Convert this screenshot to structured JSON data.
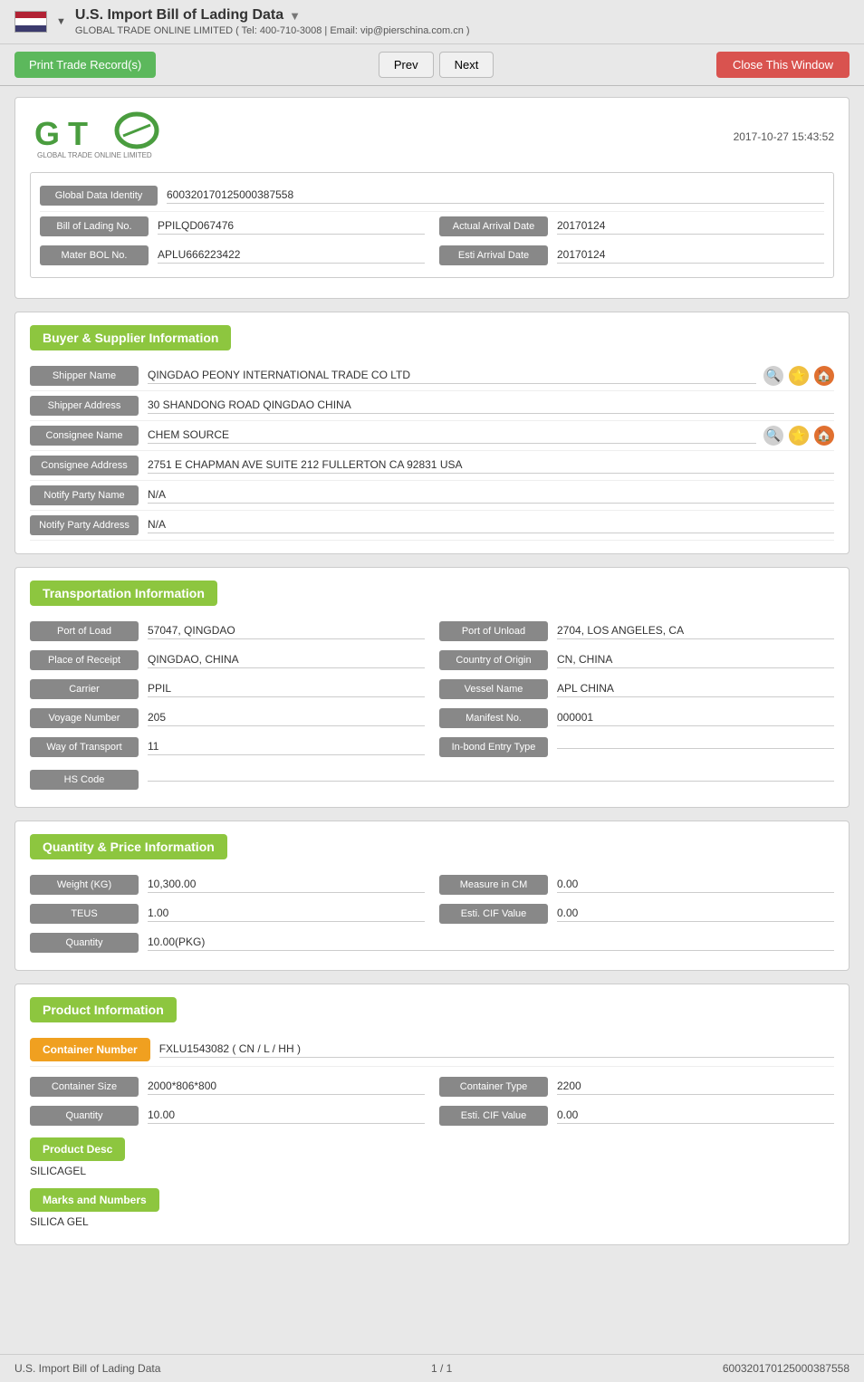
{
  "header": {
    "title": "U.S. Import Bill of Lading Data",
    "subtitle": "GLOBAL TRADE ONLINE LIMITED ( Tel: 400-710-3008 | Email: vip@pierschina.com.cn )",
    "dropdown_arrow": "▼"
  },
  "toolbar": {
    "print_label": "Print Trade Record(s)",
    "prev_label": "Prev",
    "next_label": "Next",
    "close_label": "Close This Window"
  },
  "logo": {
    "datetime": "2017-10-27 15:43:52",
    "subtitle": "GLOBAL TRADE ONLINE LIMITED"
  },
  "global_info": {
    "global_data_identity_label": "Global Data Identity",
    "global_data_identity_value": "600320170125000387558",
    "bill_of_lading_no_label": "Bill of Lading No.",
    "bill_of_lading_no_value": "PPILQD067476",
    "actual_arrival_date_label": "Actual Arrival Date",
    "actual_arrival_date_value": "20170124",
    "mater_bol_no_label": "Mater BOL No.",
    "mater_bol_no_value": "APLU666223422",
    "esti_arrival_date_label": "Esti Arrival Date",
    "esti_arrival_date_value": "20170124"
  },
  "buyer_supplier": {
    "section_title": "Buyer & Supplier Information",
    "shipper_name_label": "Shipper Name",
    "shipper_name_value": "QINGDAO PEONY INTERNATIONAL TRADE CO LTD",
    "shipper_address_label": "Shipper Address",
    "shipper_address_value": "30 SHANDONG ROAD QINGDAO CHINA",
    "consignee_name_label": "Consignee Name",
    "consignee_name_value": "CHEM SOURCE",
    "consignee_address_label": "Consignee Address",
    "consignee_address_value": "2751 E CHAPMAN AVE SUITE 212 FULLERTON CA 92831 USA",
    "notify_party_name_label": "Notify Party Name",
    "notify_party_name_value": "N/A",
    "notify_party_address_label": "Notify Party Address",
    "notify_party_address_value": "N/A"
  },
  "transportation": {
    "section_title": "Transportation Information",
    "port_of_load_label": "Port of Load",
    "port_of_load_value": "57047, QINGDAO",
    "port_of_unload_label": "Port of Unload",
    "port_of_unload_value": "2704, LOS ANGELES, CA",
    "place_of_receipt_label": "Place of Receipt",
    "place_of_receipt_value": "QINGDAO, CHINA",
    "country_of_origin_label": "Country of Origin",
    "country_of_origin_value": "CN, CHINA",
    "carrier_label": "Carrier",
    "carrier_value": "PPIL",
    "vessel_name_label": "Vessel Name",
    "vessel_name_value": "APL CHINA",
    "voyage_number_label": "Voyage Number",
    "voyage_number_value": "205",
    "manifest_no_label": "Manifest No.",
    "manifest_no_value": "000001",
    "way_of_transport_label": "Way of Transport",
    "way_of_transport_value": "11",
    "inbond_entry_type_label": "In-bond Entry Type",
    "inbond_entry_type_value": "",
    "hs_code_label": "HS Code",
    "hs_code_value": ""
  },
  "quantity_price": {
    "section_title": "Quantity & Price Information",
    "weight_kg_label": "Weight (KG)",
    "weight_kg_value": "10,300.00",
    "measure_in_cm_label": "Measure in CM",
    "measure_in_cm_value": "0.00",
    "teus_label": "TEUS",
    "teus_value": "1.00",
    "esti_cif_value_label": "Esti. CIF Value",
    "esti_cif_value": "0.00",
    "quantity_label": "Quantity",
    "quantity_value": "10.00(PKG)"
  },
  "product_info": {
    "section_title": "Product Information",
    "container_number_label": "Container Number",
    "container_number_value": "FXLU1543082 ( CN / L / HH )",
    "container_size_label": "Container Size",
    "container_size_value": "2000*806*800",
    "container_type_label": "Container Type",
    "container_type_value": "2200",
    "quantity_label": "Quantity",
    "quantity_value": "10.00",
    "esti_cif_value_label": "Esti. CIF Value",
    "esti_cif_value": "0.00",
    "product_desc_label": "Product Desc",
    "product_desc_value": "SILICAGEL",
    "marks_and_numbers_label": "Marks and Numbers",
    "marks_and_numbers_value": "SILICA GEL"
  },
  "footer": {
    "left": "U.S. Import Bill of Lading Data",
    "center": "1 / 1",
    "right": "600320170125000387558"
  }
}
